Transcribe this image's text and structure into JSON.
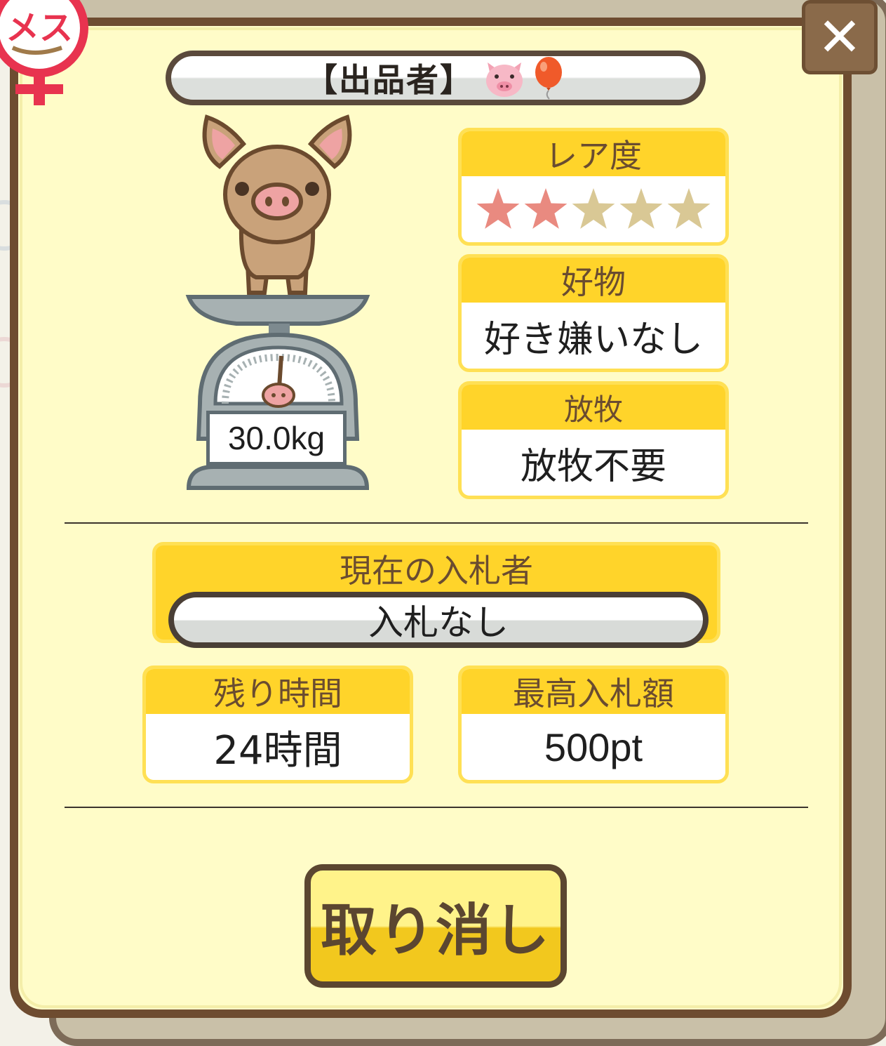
{
  "seller": {
    "label": "【出品者】",
    "icons": [
      "pig-face-icon",
      "balloon-icon"
    ]
  },
  "gender_badge": {
    "label": "メス"
  },
  "close": {
    "icon": "close-icon"
  },
  "weight": "30.0kg",
  "rarity": {
    "title": "レア度",
    "stars_filled": 2,
    "stars_total": 5
  },
  "favorite": {
    "title": "好物",
    "value": "好き嫌いなし"
  },
  "grazing": {
    "title": "放牧",
    "value": "放牧不要"
  },
  "bidder": {
    "title": "現在の入札者",
    "value": "入札なし"
  },
  "remaining": {
    "title": "残り時間",
    "value": "24時間"
  },
  "max_bid": {
    "title": "最高入札額",
    "value": "500pt"
  },
  "cancel": {
    "label": "取り消し"
  },
  "colors": {
    "panel_bg": "#fffcc8",
    "frame": "#6e4c30",
    "header_yellow": "#ffd42a",
    "star_filled": "#e98a80",
    "star_empty": "#d9c895",
    "badge_red": "#e8334f"
  }
}
